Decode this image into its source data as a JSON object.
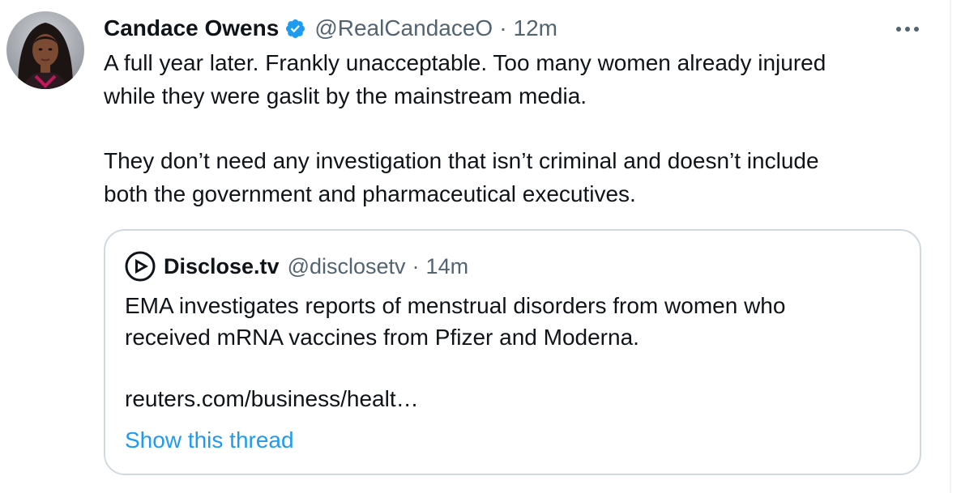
{
  "tweet": {
    "author_name": "Candace Owens",
    "handle": "@RealCandaceO",
    "separator": "·",
    "time": "12m",
    "verified": true,
    "avatar_icon": "avatar-photo",
    "more_icon": "more-horizontal-icon",
    "text_lines": [
      "A full year later. Frankly unacceptable. Too many women already injured",
      "while they were gaslit by the mainstream media.",
      "They don’t need any investigation that isn’t criminal and doesn’t include",
      "both the government and pharmaceutical executives."
    ]
  },
  "quote": {
    "author_name": "Disclose.tv",
    "handle": "@disclosetv",
    "separator": "·",
    "time": "14m",
    "logo_icon": "disclose-play-logo-icon",
    "text_lines": [
      "EMA investigates reports of menstrual disorders from women who",
      "received mRNA vaccines from Pfizer and Moderna.",
      "reuters.com/business/healt…"
    ],
    "show_thread_label": "Show this thread"
  },
  "colors": {
    "text": "#0f1419",
    "secondary_text": "#536471",
    "accent": "#1d9bf0",
    "border": "#cfd9de"
  }
}
